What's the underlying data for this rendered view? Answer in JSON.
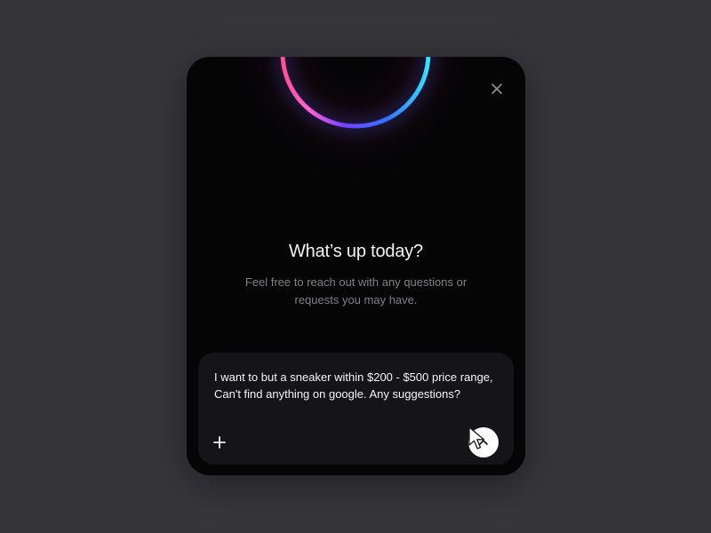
{
  "dialog": {
    "title": "What’s up today?",
    "subtitle": "Feel free to reach out with any questions or requests you may have."
  },
  "composer": {
    "message": "I want to but a sneaker within $200 - $500 price range, Can't find anything on google. Any suggestions?"
  },
  "icons": {
    "close": "close-icon",
    "attach": "plus-icon",
    "send": "chevron-up-icon",
    "cursor": "cursor-icon"
  },
  "colors": {
    "background": "#35353a",
    "modal": "#050506",
    "composer": "#151418",
    "accent_pink": "#ff4fa3",
    "accent_purple": "#7a3cff",
    "accent_blue": "#2f6dff",
    "accent_cyan": "#37d8ff",
    "send_button": "#ffffff"
  }
}
